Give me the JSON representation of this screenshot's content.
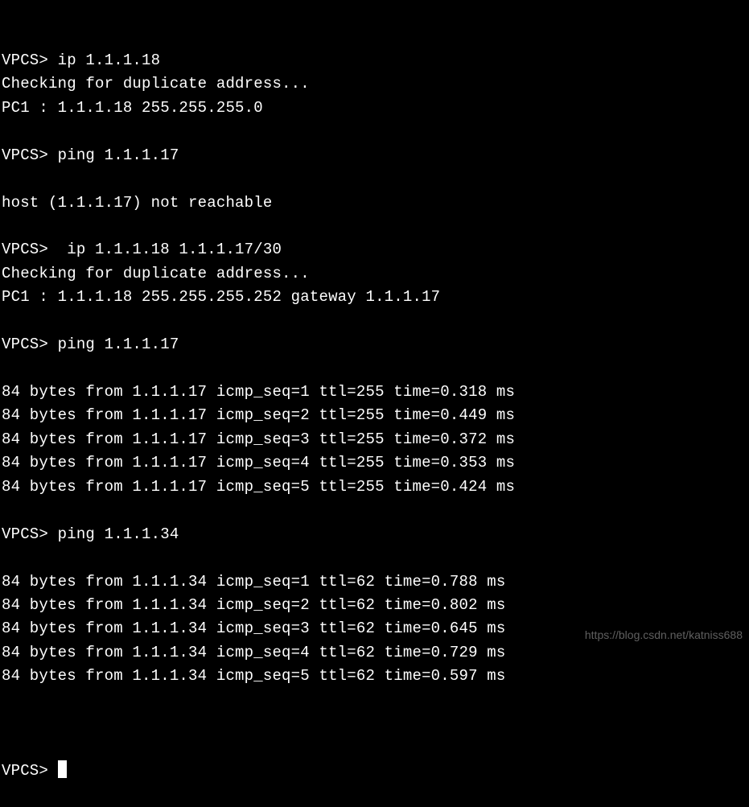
{
  "terminal": {
    "lines": [
      {
        "text": "VPCS> ip 1.1.1.18"
      },
      {
        "text": "Checking for duplicate address..."
      },
      {
        "text": "PC1 : 1.1.1.18 255.255.255.0"
      },
      {
        "text": ""
      },
      {
        "text": "VPCS> ping 1.1.1.17"
      },
      {
        "text": ""
      },
      {
        "text": "host (1.1.1.17) not reachable"
      },
      {
        "text": ""
      },
      {
        "text": "VPCS>  ip 1.1.1.18 1.1.1.17/30"
      },
      {
        "text": "Checking for duplicate address..."
      },
      {
        "text": "PC1 : 1.1.1.18 255.255.255.252 gateway 1.1.1.17"
      },
      {
        "text": ""
      },
      {
        "text": "VPCS> ping 1.1.1.17"
      },
      {
        "text": ""
      },
      {
        "text": "84 bytes from 1.1.1.17 icmp_seq=1 ttl=255 time=0.318 ms"
      },
      {
        "text": "84 bytes from 1.1.1.17 icmp_seq=2 ttl=255 time=0.449 ms"
      },
      {
        "text": "84 bytes from 1.1.1.17 icmp_seq=3 ttl=255 time=0.372 ms"
      },
      {
        "text": "84 bytes from 1.1.1.17 icmp_seq=4 ttl=255 time=0.353 ms"
      },
      {
        "text": "84 bytes from 1.1.1.17 icmp_seq=5 ttl=255 time=0.424 ms"
      },
      {
        "text": ""
      },
      {
        "text": "VPCS> ping 1.1.1.34"
      },
      {
        "text": ""
      },
      {
        "text": "84 bytes from 1.1.1.34 icmp_seq=1 ttl=62 time=0.788 ms"
      },
      {
        "text": "84 bytes from 1.1.1.34 icmp_seq=2 ttl=62 time=0.802 ms"
      },
      {
        "text": "84 bytes from 1.1.1.34 icmp_seq=3 ttl=62 time=0.645 ms"
      },
      {
        "text": "84 bytes from 1.1.1.34 icmp_seq=4 ttl=62 time=0.729 ms"
      },
      {
        "text": "84 bytes from 1.1.1.34 icmp_seq=5 ttl=62 time=0.597 ms"
      },
      {
        "text": ""
      }
    ],
    "prompt_final": "VPCS> "
  },
  "watermark": "https://blog.csdn.net/katniss688"
}
